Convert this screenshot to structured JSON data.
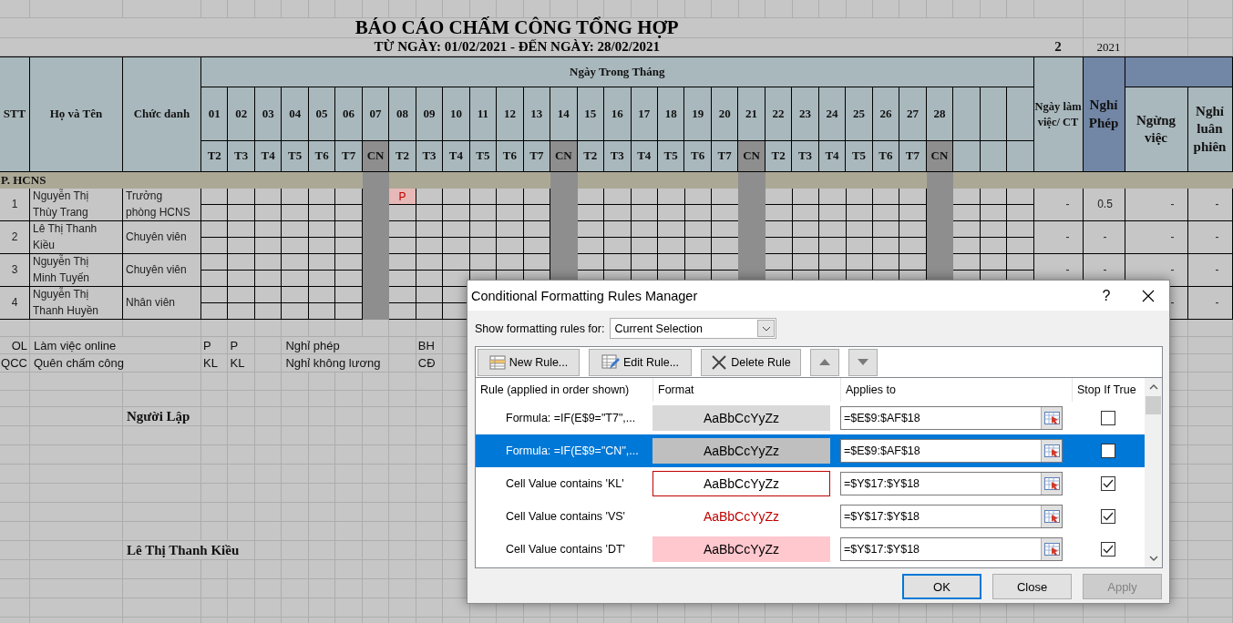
{
  "sheet": {
    "title": "BÁO CÁO CHẤM CÔNG TỔNG HỢP",
    "subtitle": "TỪ NGÀY: 01/02/2021 - ĐẾN NGÀY: 28/02/2021",
    "month": "2",
    "year": "2021",
    "columns": {
      "stt": "STT",
      "name": "Họ và Tên",
      "title": "Chức danh",
      "days_group": "Ngày Trong Tháng",
      "work_days": "Ngày làm việc/ CT",
      "leave": "Nghỉ Phép",
      "suspended": "Ngừng việc",
      "rotation": "Nghỉ luân phiên"
    },
    "days": [
      {
        "number": "01",
        "weekday": "T2",
        "sunday": false
      },
      {
        "number": "02",
        "weekday": "T3",
        "sunday": false
      },
      {
        "number": "03",
        "weekday": "T4",
        "sunday": false
      },
      {
        "number": "04",
        "weekday": "T5",
        "sunday": false
      },
      {
        "number": "05",
        "weekday": "T6",
        "sunday": false
      },
      {
        "number": "06",
        "weekday": "T7",
        "sunday": false
      },
      {
        "number": "07",
        "weekday": "CN",
        "sunday": true
      },
      {
        "number": "08",
        "weekday": "T2",
        "sunday": false
      },
      {
        "number": "09",
        "weekday": "T3",
        "sunday": false
      },
      {
        "number": "10",
        "weekday": "T4",
        "sunday": false
      },
      {
        "number": "11",
        "weekday": "T5",
        "sunday": false
      },
      {
        "number": "12",
        "weekday": "T6",
        "sunday": false
      },
      {
        "number": "13",
        "weekday": "T7",
        "sunday": false
      },
      {
        "number": "14",
        "weekday": "CN",
        "sunday": true
      },
      {
        "number": "15",
        "weekday": "T2",
        "sunday": false
      },
      {
        "number": "16",
        "weekday": "T3",
        "sunday": false
      },
      {
        "number": "17",
        "weekday": "T4",
        "sunday": false
      },
      {
        "number": "18",
        "weekday": "T5",
        "sunday": false
      },
      {
        "number": "19",
        "weekday": "T6",
        "sunday": false
      },
      {
        "number": "20",
        "weekday": "T7",
        "sunday": false
      },
      {
        "number": "21",
        "weekday": "CN",
        "sunday": true
      },
      {
        "number": "22",
        "weekday": "T2",
        "sunday": false
      },
      {
        "number": "23",
        "weekday": "T3",
        "sunday": false
      },
      {
        "number": "24",
        "weekday": "T4",
        "sunday": false
      },
      {
        "number": "25",
        "weekday": "T5",
        "sunday": false
      },
      {
        "number": "26",
        "weekday": "T6",
        "sunday": false
      },
      {
        "number": "27",
        "weekday": "T7",
        "sunday": false
      },
      {
        "number": "28",
        "weekday": "CN",
        "sunday": true
      }
    ],
    "group": "P. HCNS",
    "employees": [
      {
        "stt": "1",
        "name": "Nguyễn Thị Thùy Trang",
        "title": "Trưởng phòng HCNS",
        "codes": [
          {
            "kind": "empty"
          },
          {
            "kind": "empty"
          },
          {
            "kind": "empty"
          },
          {
            "kind": "empty"
          },
          {
            "kind": "empty"
          },
          {
            "kind": "empty"
          },
          {
            "kind": "empty"
          },
          {
            "kind": "code",
            "code": "P"
          }
        ],
        "work_days": "-",
        "leave": "0.5",
        "suspended": "-",
        "rotation": "-"
      },
      {
        "stt": "2",
        "name": "Lê Thị Thanh Kiều",
        "title": "Chuyên viên",
        "work_days": "-",
        "leave": "-",
        "suspended": "-",
        "rotation": "-"
      },
      {
        "stt": "3",
        "name": "Nguyễn Thị Minh Tuyến",
        "title": "Chuyên viên",
        "work_days": "-",
        "leave": "-",
        "suspended": "-",
        "rotation": "-"
      },
      {
        "stt": "4",
        "name": "Nguyễn Thị Thanh Huyền",
        "title": "Nhân viên",
        "suspended": "-",
        "rotation": "-"
      }
    ],
    "legend": [
      {
        "code_1": "OL",
        "label_1": "Làm việc online",
        "code_2": "P",
        "code_3": "P",
        "label_2": "Nghỉ phép",
        "code_4": "BH"
      },
      {
        "code_1": "QCC",
        "label_1": "Quên chấm công",
        "code_2": "KL",
        "code_3": "KL",
        "label_2": "Nghỉ không lương",
        "code_4": "CĐ"
      }
    ],
    "signature": {
      "label": "Người Lập",
      "name": "Lê Thị Thanh Kiều"
    }
  },
  "dialog": {
    "title": "Conditional Formatting Rules Manager",
    "help": "?",
    "show_label": "Show formatting rules for:",
    "show_value": "Current Selection",
    "toolbar": [
      {
        "kind": "new",
        "label": "New Rule..."
      },
      {
        "kind": "edit",
        "label": "Edit Rule..."
      },
      {
        "kind": "delete",
        "label": "Delete Rule"
      },
      {
        "kind": "up"
      },
      {
        "kind": "down"
      }
    ],
    "headers": [
      "Rule (applied in order shown)",
      "Format",
      "Applies to",
      "Stop If True"
    ],
    "rules": [
      {
        "rule": "Formula: =IF(E$9=\"T7\",...",
        "preview": {
          "text": "AaBbCcYyZz",
          "kind": "fill",
          "color": "#d9d9d9"
        },
        "applies_to": "=$E$9:$AF$18",
        "stop_if_true": false,
        "selected": false
      },
      {
        "rule": "Formula: =IF(E$9=\"CN\",...",
        "preview": {
          "text": "AaBbCcYyZz",
          "kind": "fill",
          "color": "#bfbfbf"
        },
        "applies_to": "=$E$9:$AF$18",
        "stop_if_true": false,
        "selected": true
      },
      {
        "rule": "Cell Value contains 'KL'",
        "preview": {
          "text": "AaBbCcYyZz",
          "kind": "border",
          "color": "#c00000"
        },
        "applies_to": "=$Y$17:$Y$18",
        "stop_if_true": true,
        "selected": false
      },
      {
        "rule": "Cell Value contains 'VS'",
        "preview": {
          "text": "AaBbCcYyZz",
          "kind": "font",
          "color": "#c00000"
        },
        "applies_to": "=$Y$17:$Y$18",
        "stop_if_true": true,
        "selected": false
      },
      {
        "rule": "Cell Value contains 'DT'",
        "preview": {
          "text": "AaBbCcYyZz",
          "kind": "fill",
          "color": "#ffc7ce"
        },
        "applies_to": "=$Y$17:$Y$18",
        "stop_if_true": true,
        "selected": false
      }
    ],
    "buttons": [
      {
        "label": "OK",
        "kind": "default",
        "disabled": false
      },
      {
        "label": "Close",
        "kind": "normal",
        "disabled": false
      },
      {
        "label": "Apply",
        "kind": "normal",
        "disabled": true
      }
    ]
  }
}
